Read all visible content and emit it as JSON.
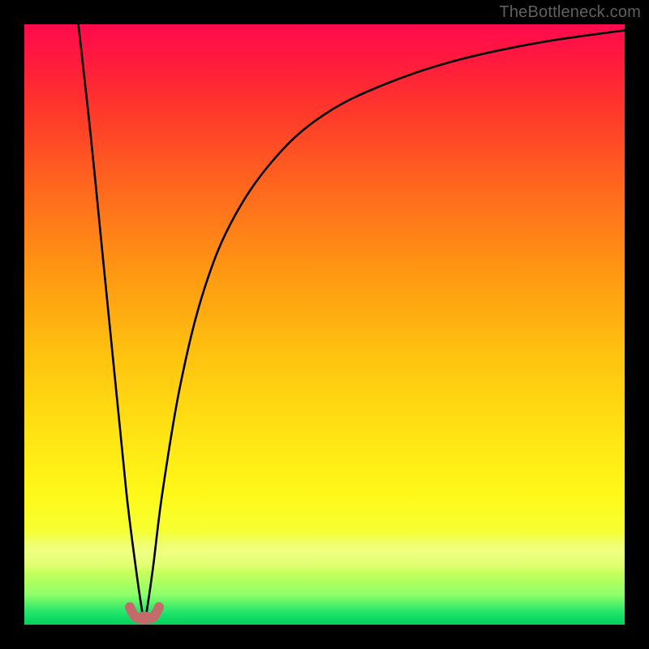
{
  "watermark": {
    "text": "TheBottleneck.com"
  },
  "colors": {
    "frame": "#000000",
    "curve": "#000000",
    "bump": "#c46a6a",
    "gradient_stops": [
      "#ff0a4d",
      "#ff6a1e",
      "#ffe314",
      "#04d05e"
    ]
  },
  "chart_data": {
    "type": "line",
    "title": "",
    "xlabel": "",
    "ylabel": "",
    "xlim": [
      0,
      100
    ],
    "ylim": [
      0,
      100
    ],
    "grid": false,
    "series": [
      {
        "name": "bottleneck-curve",
        "x": [
          9,
          11,
          13,
          15,
          17,
          18.5,
          19.5,
          20,
          20.5,
          21.5,
          23,
          26,
          30,
          35,
          42,
          50,
          60,
          72,
          86,
          100
        ],
        "values": [
          100,
          82,
          62,
          42,
          22,
          10,
          3,
          0.5,
          3,
          10,
          22,
          40,
          56,
          68,
          78,
          85,
          90,
          94,
          97,
          99
        ]
      }
    ],
    "annotations": [
      {
        "name": "valley-bump",
        "x": 20,
        "y": 0.5
      }
    ]
  }
}
